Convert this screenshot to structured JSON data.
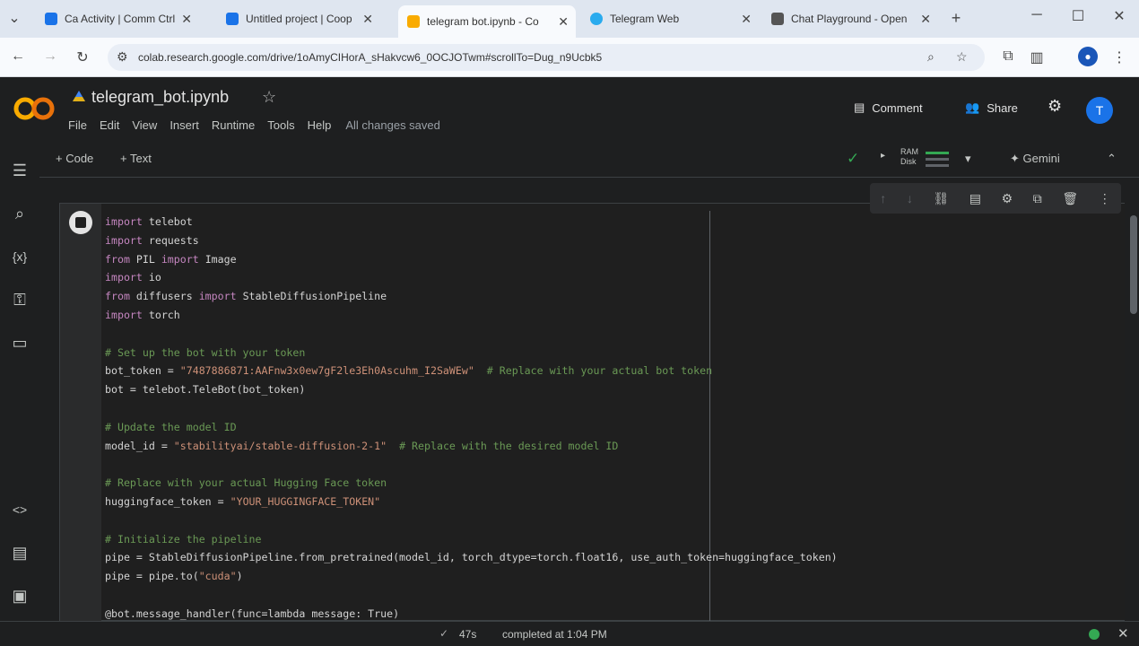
{
  "browser": {
    "tabs": [
      {
        "title": "Ca Activity | Comm Ctrl",
        "color": "#1a73e8"
      },
      {
        "title": "Untitled project | Coop",
        "color": "#1a73e8"
      },
      {
        "title": "telegram bot.ipynb - Co",
        "color": "#f9ab00"
      },
      {
        "title": "Telegram Web",
        "color": "#2aabee"
      },
      {
        "title": "Chat Playground - Open",
        "color": "#555555"
      }
    ],
    "new_tab": "+",
    "url": "colab.research.google.com/drive/1oAmyCIHorA_sHakvcw6_0OCJOTwm#scrollTo=Dug_n9Ucbk5"
  },
  "colab": {
    "title": "telegram_bot.ipynb",
    "menus": [
      "File",
      "Edit",
      "View",
      "Insert",
      "Runtime",
      "Tools",
      "Help"
    ],
    "saved_status": "All changes saved",
    "comment_label": "Comment",
    "share_label": "Share",
    "avatar_letter": "T",
    "toolbar": {
      "code_label": "+ Code",
      "text_label": "+ Text",
      "ram_label": "RAM",
      "disk_label": "Disk",
      "gemini_label": "Gemini"
    }
  },
  "code_lines": [
    "import telebot",
    "import requests",
    "from PIL import Image",
    "import io",
    "from diffusers import StableDiffusionPipeline",
    "import torch",
    "",
    "# Set up the bot with your token",
    "bot_token = \"7487886871:AAFnw3x0ew7gF2le3Eh0Ascuhm_I2SaWEw\"  # Replace with your actual bot token",
    "bot = telebot.TeleBot(bot_token)",
    "",
    "# Update the model ID",
    "model_id = \"stabilityai/stable-diffusion-2-1\"  # Replace with the desired model ID",
    "",
    "# Replace with your actual Hugging Face token",
    "huggingface_token = \"YOUR_HUGGINGFACE_TOKEN\"",
    "",
    "# Initialize the pipeline",
    "pipe = StableDiffusionPipeline.from_pretrained(model_id, torch_dtype=torch.float16, use_auth_token=huggingface_token)",
    "pipe = pipe.to(\"cuda\")",
    "",
    "@bot.message_handler(func=lambda message: True)"
  ],
  "status": {
    "elapsed": "47s",
    "completed": "completed at 1:04 PM"
  }
}
